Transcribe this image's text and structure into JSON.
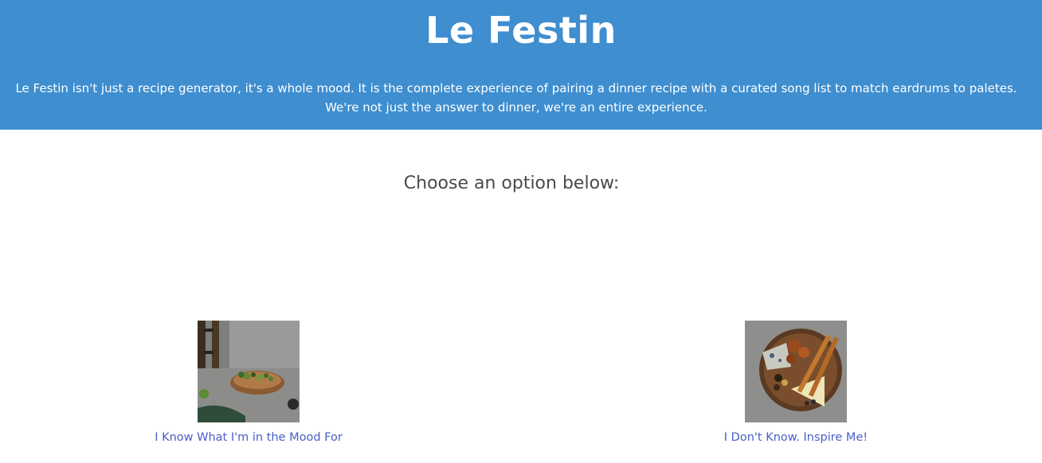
{
  "header": {
    "title": "Le Festin",
    "description": "Le Festin isn't just a recipe generator, it's a whole mood. It is the complete experience of pairing a dinner recipe with a curated song list to match eardrums to paletes. We're not just the answer to dinner, we're an entire experience."
  },
  "main": {
    "prompt": "Choose an option below:",
    "options": [
      {
        "label": "I Know What I'm in the Mood For",
        "image": "plated-food-photo"
      },
      {
        "label": "I Don't Know. Inspire Me!",
        "image": "charcuterie-board-photo"
      }
    ]
  },
  "colors": {
    "header_bg": "#3e8ed0",
    "link": "#485fc7",
    "text": "#4a4a4a"
  }
}
